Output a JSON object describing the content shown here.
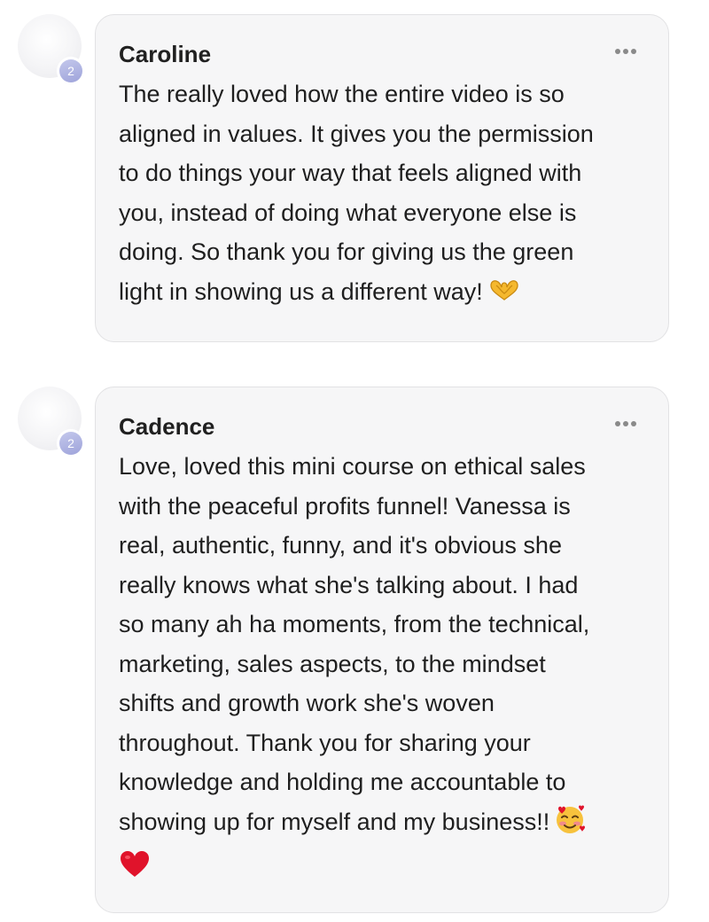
{
  "comments": [
    {
      "author": "Caroline",
      "avatar_badge": "2",
      "menu_icon": "more-horizontal-icon",
      "text": "The really loved how the entire video is so\naligned in values. It gives you the permission\nto do things your way that feels aligned with\nyou, instead of doing what everyone else is\ndoing. So thank you for giving us the green\nlight in showing us a different way!",
      "trailing_emoji": "heart-hands-emoji"
    },
    {
      "author": "Cadence",
      "avatar_badge": "2",
      "menu_icon": "more-horizontal-icon",
      "text": "Love, loved this mini course on ethical sales\nwith the peaceful profits funnel! Vanessa is\nreal, authentic, funny, and it's obvious she\nreally knows what she's talking about. I had\nso many ah ha moments, from the technical,\nmarketing, sales aspects, to the mindset\nshifts and growth work she's woven\nthroughout. Thank you for sharing your\nknowledge and holding me accountable to\nshowing up for myself and my business!!",
      "trailing_emoji": [
        "smiling-face-with-hearts-emoji",
        "red-heart-emoji"
      ]
    }
  ],
  "colors": {
    "bubble_bg": "#f6f6f7",
    "badge": "#9ea3da",
    "heart": "#e0132b",
    "emoji_yellow": "#f5b82e"
  }
}
